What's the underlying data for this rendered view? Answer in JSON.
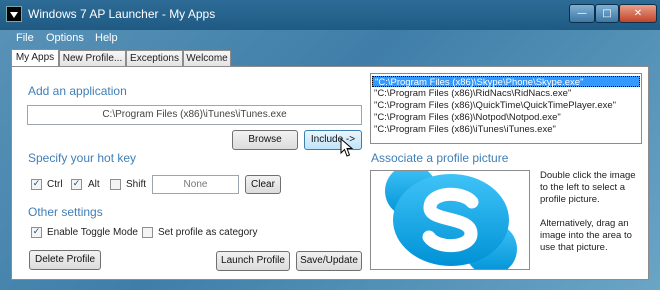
{
  "window": {
    "title": "Windows 7 AP Launcher - My Apps"
  },
  "menu": [
    "File",
    "Options",
    "Help"
  ],
  "tabs": [
    "My Apps",
    "New Profile...",
    "Exceptions",
    "Welcome"
  ],
  "add_application": {
    "heading": "Add an application",
    "path_value": "C:\\Program Files (x86)\\iTunes\\iTunes.exe",
    "browse_label": "Browse",
    "include_label": "Include ->"
  },
  "hotkey": {
    "heading": "Specify your hot key",
    "ctrl_label": "Ctrl",
    "ctrl_checked": true,
    "alt_label": "Alt",
    "alt_checked": true,
    "shift_label": "Shift",
    "shift_checked": false,
    "key_value": "None",
    "clear_label": "Clear"
  },
  "other_settings": {
    "heading": "Other settings",
    "toggle_label": "Enable Toggle Mode",
    "toggle_checked": true,
    "category_label": "Set profile as category",
    "category_checked": false
  },
  "buttons": {
    "delete": "Delete Profile",
    "launch": "Launch Profile",
    "save": "Save/Update"
  },
  "app_list": {
    "items": [
      "\"C:\\Program Files (x86)\\Skype\\Phone\\Skype.exe\"",
      "\"C:\\Program Files (x86)\\RidNacs\\RidNacs.exe\"",
      "\"C:\\Program Files (x86)\\QuickTime\\QuickTimePlayer.exe\"",
      "\"C:\\Program Files (x86)\\Notpod\\Notpod.exe\"",
      "\"C:\\Program Files (x86)\\iTunes\\iTunes.exe\""
    ],
    "selected_index": 0
  },
  "profile_picture": {
    "heading": "Associate a profile picture",
    "description_1": "Double click the image to the left to select a profile picture.",
    "description_2": "Alternatively, drag an image into the area to use that picture.",
    "icon": "skype-logo"
  },
  "colors": {
    "accent": "#3f7fb8",
    "selection": "#3399ff",
    "skype_blue": "#00aff0"
  }
}
